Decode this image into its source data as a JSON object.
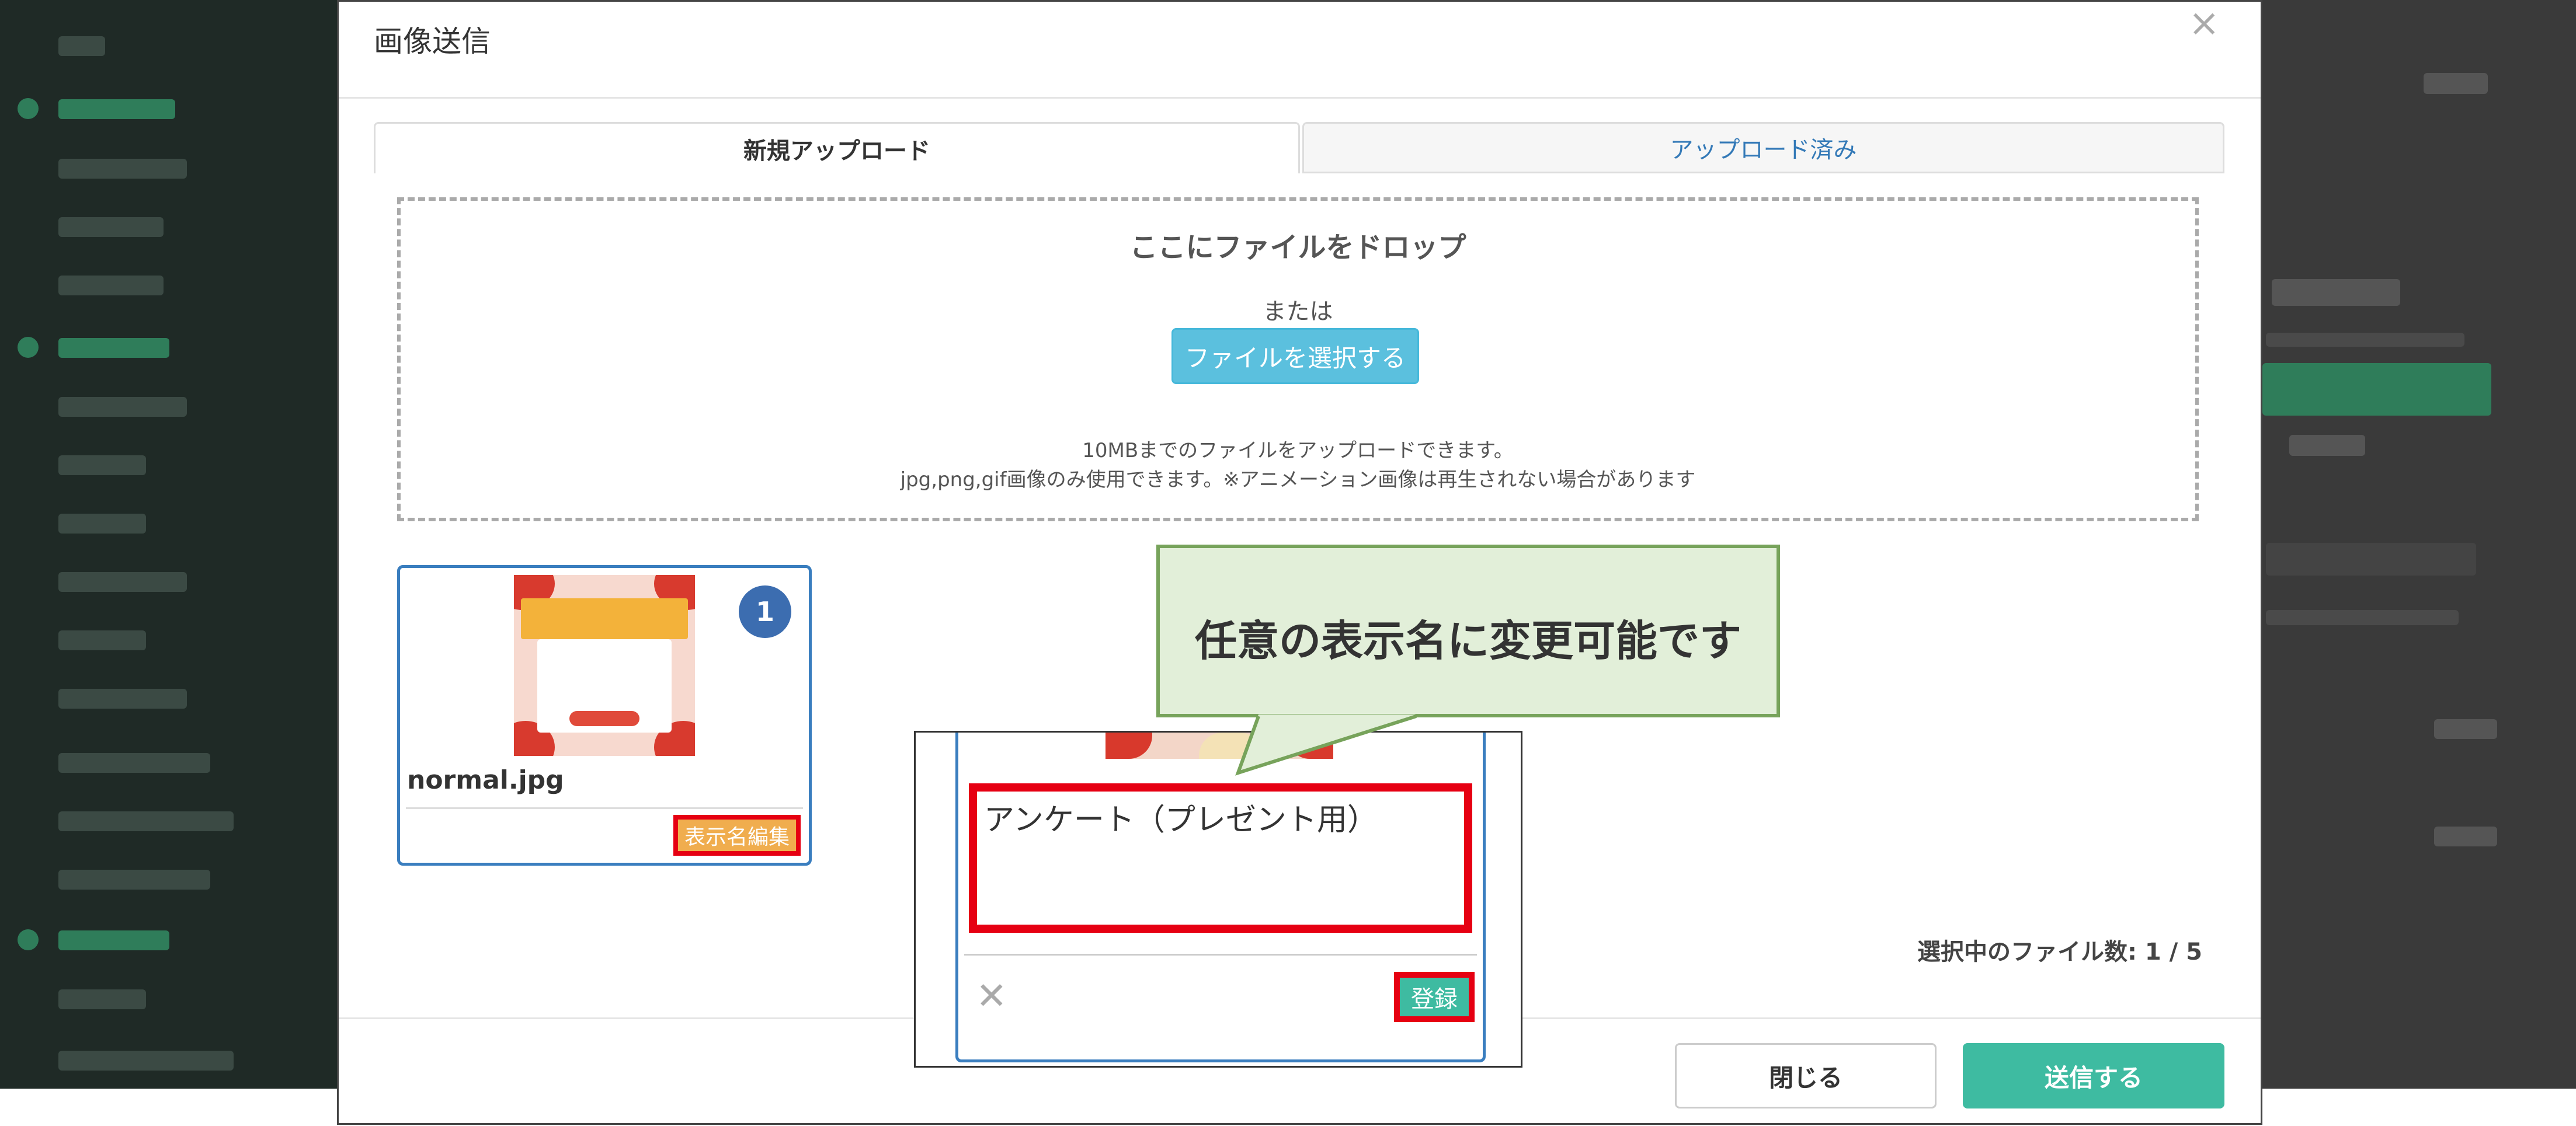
{
  "modal": {
    "title": "画像送信",
    "close_glyph": "×",
    "tabs": [
      {
        "label": "新規アップロード",
        "active": true
      },
      {
        "label": "アップロード済み",
        "active": false
      }
    ],
    "drop_zone": {
      "title": "ここにファイルをドロップ",
      "or_text": "または",
      "select_button": "ファイルを選択する",
      "note_size": "10MBまでのファイルをアップロードできます。",
      "note_types": "jpg,png,gif画像のみ使用できます。※アニメーション画像は再生されない場合があります"
    },
    "file_card": {
      "index": "1",
      "file_name": "normal.jpg",
      "edit_button": "表示名編集"
    },
    "selected_count": "選択中のファイル数: 1 / 5",
    "close_button": "閉じる",
    "send_button": "送信する"
  },
  "inset": {
    "display_name_value": "アンケート（プレゼント用）",
    "cancel_glyph": "✕",
    "register_button": "登録"
  },
  "callout": {
    "text": "任意の表示名に変更可能です"
  },
  "colors": {
    "primary_green": "#3ebba1",
    "info_blue": "#5bc0de",
    "highlight_red": "#e60012",
    "card_border": "#3a7ebf",
    "callout_fill": "#e2efd9",
    "callout_border": "#77a35b",
    "edit_orange": "#f0ad4e"
  }
}
